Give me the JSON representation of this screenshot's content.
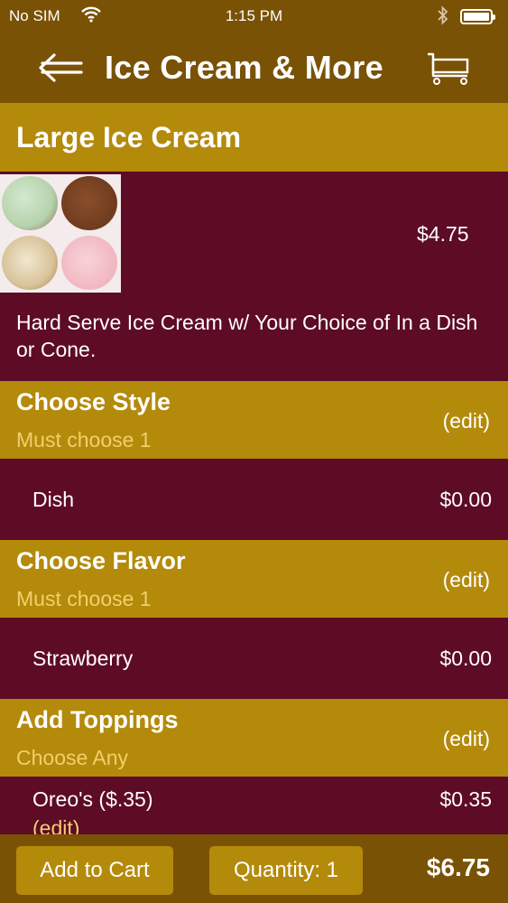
{
  "status_bar": {
    "carrier": "No SIM",
    "time": "1:15 PM"
  },
  "nav": {
    "title": "Ice Cream & More"
  },
  "item": {
    "name": "Large Ice Cream",
    "price": "$4.75",
    "description": "Hard Serve Ice Cream w/ Your Choice of In a Dish or Cone."
  },
  "groups": [
    {
      "title": "Choose Style",
      "subtitle": "Must choose 1",
      "edit": "(edit)",
      "selection": {
        "name": "Dish",
        "price": "$0.00"
      }
    },
    {
      "title": "Choose Flavor",
      "subtitle": "Must choose 1",
      "edit": "(edit)",
      "selection": {
        "name": "Strawberry",
        "price": "$0.00"
      }
    },
    {
      "title": "Add Toppings",
      "subtitle": "Choose Any",
      "edit": "(edit)",
      "selection": {
        "name": "Oreo's ($.35)",
        "price": "$0.35",
        "edit": "(edit)"
      }
    }
  ],
  "footer": {
    "add_to_cart": "Add to Cart",
    "quantity": "Quantity: 1",
    "total": "$6.75"
  },
  "colors": {
    "header": "#7a5206",
    "gold": "#b48a0a",
    "maroon": "#5e0b26",
    "subtitle": "#f2cf6c"
  },
  "icons": [
    "wifi-icon",
    "bluetooth-icon",
    "battery-icon",
    "back-arrow-icon",
    "cart-icon"
  ]
}
